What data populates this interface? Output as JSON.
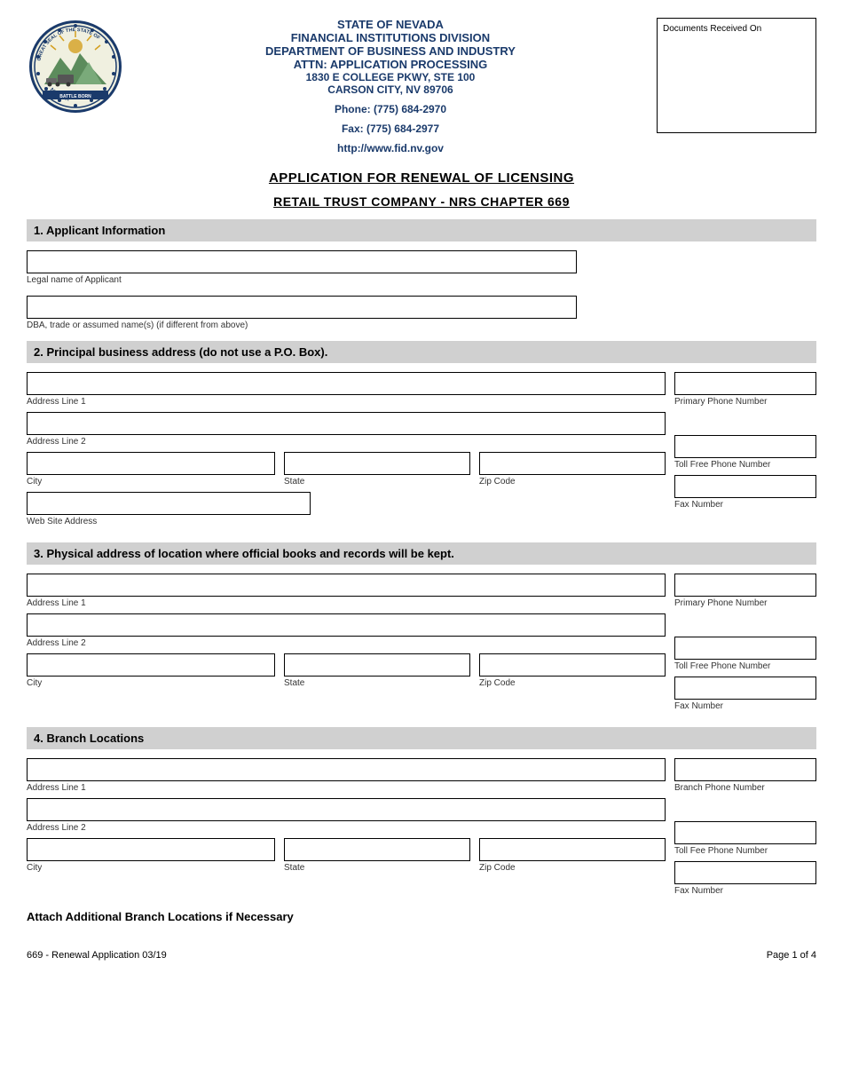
{
  "header": {
    "agency_line1": "STATE OF NEVADA",
    "agency_line2": "FINANCIAL INSTITUTIONS DIVISION",
    "agency_line3": "DEPARTMENT OF BUSINESS AND INDUSTRY",
    "agency_line4": "ATTN:  APPLICATION PROCESSING",
    "agency_line5": "1830 E COLLEGE PKWY, STE 100",
    "agency_line6": "CARSON CITY, NV 89706",
    "phone": "Phone:  (775) 684-2970",
    "fax": "Fax:  (775) 684-2977",
    "website": "http://www.fid.nv.gov",
    "docs_received_label": "Documents Received On"
  },
  "titles": {
    "main_title": "APPLICATION FOR RENEWAL OF LICENSING",
    "sub_title": "RETAIL TRUST COMPANY  - NRS CHAPTER 669"
  },
  "sections": {
    "section1": {
      "header": "1. Applicant Information",
      "field1_label": "Legal name of Applicant",
      "field2_label": "DBA, trade or assumed name(s) (if different from above)"
    },
    "section2": {
      "header": "2. Principal business address (do not use a P.O. Box).",
      "address_line1_label": "Address Line 1",
      "address_line2_label": "Address Line 2",
      "city_label": "City",
      "state_label": "State",
      "zip_label": "Zip Code",
      "website_label": "Web Site Address",
      "primary_phone_label": "Primary Phone Number",
      "toll_free_label": "Toll Free Phone Number",
      "fax_label": "Fax Number"
    },
    "section3": {
      "header": "3. Physical address of location where official books and records will be kept.",
      "address_line1_label": "Address Line 1",
      "address_line2_label": "Address Line 2",
      "city_label": "City",
      "state_label": "State",
      "zip_label": "Zip Code",
      "primary_phone_label": "Primary Phone Number",
      "toll_free_label": "Toll Free Phone Number",
      "fax_label": "Fax Number"
    },
    "section4": {
      "header": "4. Branch Locations",
      "address_line1_label": "Address Line 1",
      "address_line2_label": "Address Line 2",
      "city_label": "City",
      "state_label": "State",
      "zip_label": "Zip Code",
      "branch_phone_label": "Branch Phone Number",
      "toll_fee_label": "Toll Fee Phone Number",
      "fax_label": "Fax Number"
    }
  },
  "footer": {
    "attach_note": "Attach Additional Branch Locations if Necessary",
    "form_code": "669 - Renewal Application 03/19",
    "page_info": "Page 1 of 4"
  }
}
